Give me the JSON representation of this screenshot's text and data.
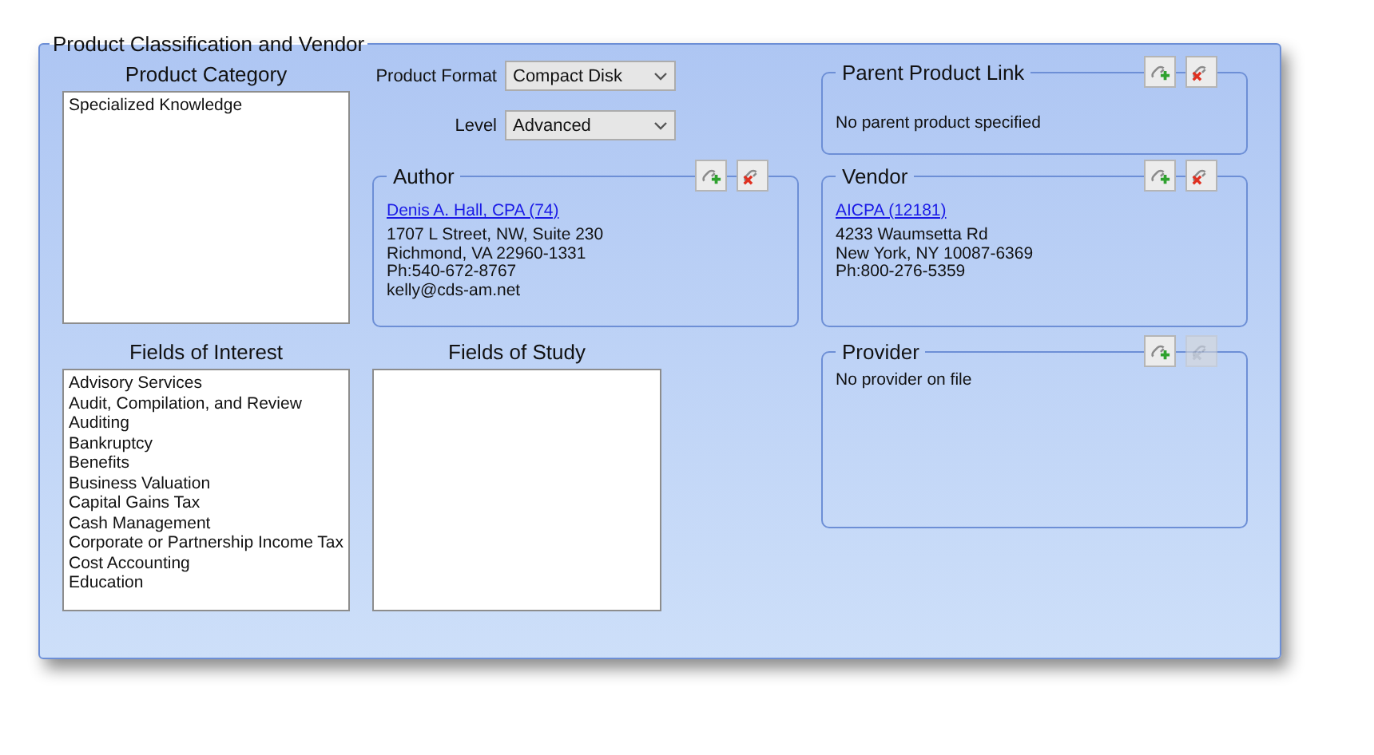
{
  "panel": {
    "title": "Product Classification and Vendor"
  },
  "product_category": {
    "heading": "Product Category",
    "items": [
      "Specialized Knowledge"
    ]
  },
  "fields": [
    {
      "label": "Product Format",
      "value": "Compact Disk"
    },
    {
      "label": "Level",
      "value": "Advanced"
    }
  ],
  "parent_product_link": {
    "title": "Parent Product Link",
    "text": "No parent product specified",
    "buttons": [
      {
        "kind": "add",
        "disabled": false
      },
      {
        "kind": "remove",
        "disabled": false
      }
    ]
  },
  "author": {
    "title": "Author",
    "link": "Denis A. Hall, CPA (74)",
    "lines": [
      "1707 L Street, NW, Suite 230",
      "Richmond, VA  22960-1331",
      "Ph:540-672-8767",
      "kelly@cds-am.net"
    ],
    "buttons": [
      {
        "kind": "add",
        "disabled": false
      },
      {
        "kind": "remove",
        "disabled": false
      }
    ]
  },
  "vendor": {
    "title": "Vendor",
    "link": "AICPA (12181)",
    "lines": [
      "4233 Waumsetta Rd",
      "New York, NY  10087-6369",
      "Ph:800-276-5359"
    ],
    "buttons": [
      {
        "kind": "add",
        "disabled": false
      },
      {
        "kind": "remove",
        "disabled": false
      }
    ]
  },
  "fields_of_interest": {
    "heading": "Fields of Interest",
    "items": [
      "Advisory Services",
      "Audit, Compilation, and Review",
      "Auditing",
      "Bankruptcy",
      "Benefits",
      "Business Valuation",
      "Capital Gains Tax",
      "Cash Management",
      "Corporate or Partnership Income Tax",
      "Cost Accounting",
      "Education"
    ]
  },
  "fields_of_study": {
    "heading": "Fields of Study"
  },
  "provider": {
    "title": "Provider",
    "text": "No provider on file",
    "buttons": [
      {
        "kind": "add",
        "disabled": false
      },
      {
        "kind": "remove",
        "disabled": true
      }
    ]
  }
}
